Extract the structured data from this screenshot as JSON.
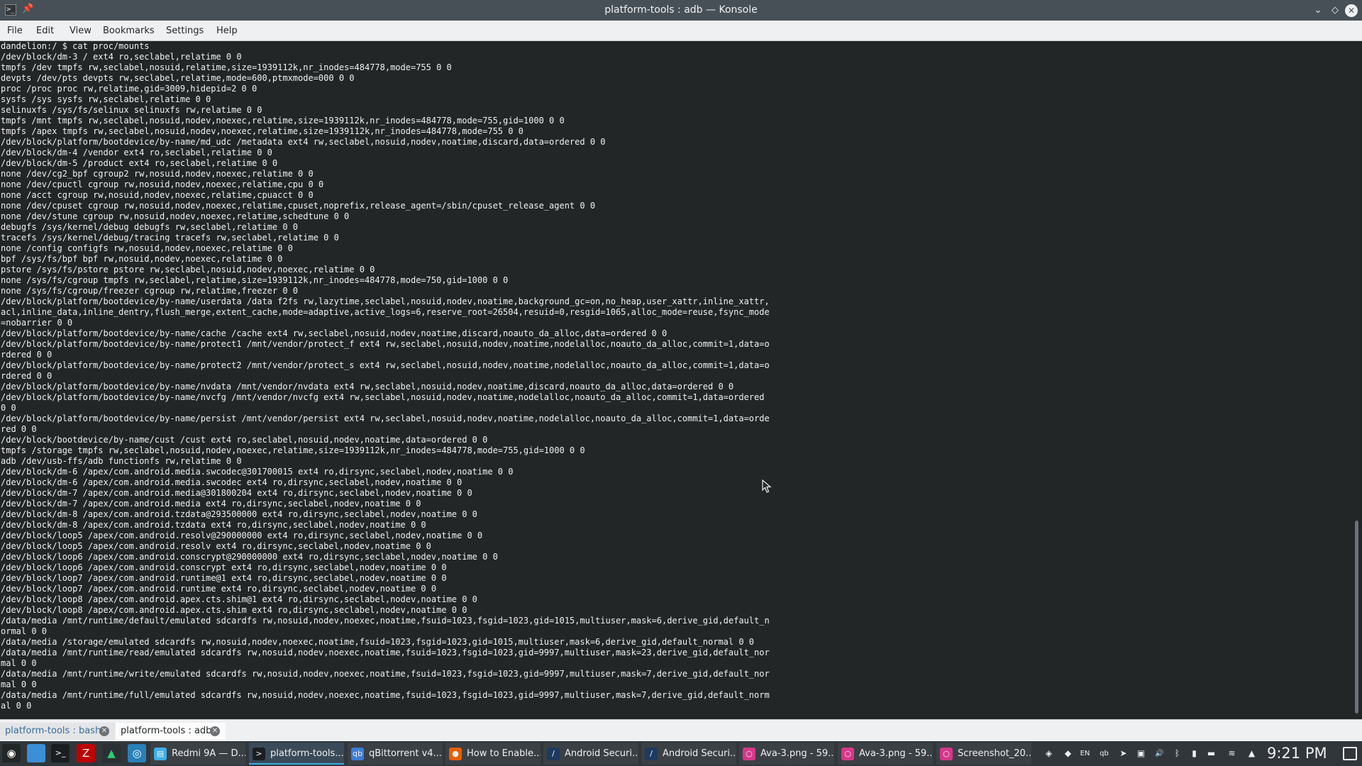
{
  "window": {
    "title": "platform-tools : adb — Konsole",
    "app_icon_glyph": ">_",
    "pin_glyph": "📌",
    "min_glyph": "⌄",
    "max_glyph": "◇",
    "close_glyph": "✕"
  },
  "menu": [
    "File",
    "Edit",
    "View",
    "Bookmarks",
    "Settings",
    "Help"
  ],
  "terminal_lines": [
    "dandelion:/ $ cat proc/mounts",
    "/dev/block/dm-3 / ext4 ro,seclabel,relatime 0 0",
    "tmpfs /dev tmpfs rw,seclabel,nosuid,relatime,size=1939112k,nr_inodes=484778,mode=755 0 0",
    "devpts /dev/pts devpts rw,seclabel,relatime,mode=600,ptmxmode=000 0 0",
    "proc /proc proc rw,relatime,gid=3009,hidepid=2 0 0",
    "sysfs /sys sysfs rw,seclabel,relatime 0 0",
    "selinuxfs /sys/fs/selinux selinuxfs rw,relatime 0 0",
    "tmpfs /mnt tmpfs rw,seclabel,nosuid,nodev,noexec,relatime,size=1939112k,nr_inodes=484778,mode=755,gid=1000 0 0",
    "tmpfs /apex tmpfs rw,seclabel,nosuid,nodev,noexec,relatime,size=1939112k,nr_inodes=484778,mode=755 0 0",
    "/dev/block/platform/bootdevice/by-name/md_udc /metadata ext4 rw,seclabel,nosuid,nodev,noatime,discard,data=ordered 0 0",
    "/dev/block/dm-4 /vendor ext4 ro,seclabel,relatime 0 0",
    "/dev/block/dm-5 /product ext4 ro,seclabel,relatime 0 0",
    "none /dev/cg2_bpf cgroup2 rw,nosuid,nodev,noexec,relatime 0 0",
    "none /dev/cpuctl cgroup rw,nosuid,nodev,noexec,relatime,cpu 0 0",
    "none /acct cgroup rw,nosuid,nodev,noexec,relatime,cpuacct 0 0",
    "none /dev/cpuset cgroup rw,nosuid,nodev,noexec,relatime,cpuset,noprefix,release_agent=/sbin/cpuset_release_agent 0 0",
    "none /dev/stune cgroup rw,nosuid,nodev,noexec,relatime,schedtune 0 0",
    "debugfs /sys/kernel/debug debugfs rw,seclabel,relatime 0 0",
    "tracefs /sys/kernel/debug/tracing tracefs rw,seclabel,relatime 0 0",
    "none /config configfs rw,nosuid,nodev,noexec,relatime 0 0",
    "bpf /sys/fs/bpf bpf rw,nosuid,nodev,noexec,relatime 0 0",
    "pstore /sys/fs/pstore pstore rw,seclabel,nosuid,nodev,noexec,relatime 0 0",
    "none /sys/fs/cgroup tmpfs rw,seclabel,relatime,size=1939112k,nr_inodes=484778,mode=750,gid=1000 0 0",
    "none /sys/fs/cgroup/freezer cgroup rw,relatime,freezer 0 0",
    "/dev/block/platform/bootdevice/by-name/userdata /data f2fs rw,lazytime,seclabel,nosuid,nodev,noatime,background_gc=on,no_heap,user_xattr,inline_xattr,",
    "acl,inline_data,inline_dentry,flush_merge,extent_cache,mode=adaptive,active_logs=6,reserve_root=26504,resuid=0,resgid=1065,alloc_mode=reuse,fsync_mode",
    "=nobarrier 0 0",
    "/dev/block/platform/bootdevice/by-name/cache /cache ext4 rw,seclabel,nosuid,nodev,noatime,discard,noauto_da_alloc,data=ordered 0 0",
    "/dev/block/platform/bootdevice/by-name/protect1 /mnt/vendor/protect_f ext4 rw,seclabel,nosuid,nodev,noatime,nodelalloc,noauto_da_alloc,commit=1,data=o",
    "rdered 0 0",
    "/dev/block/platform/bootdevice/by-name/protect2 /mnt/vendor/protect_s ext4 rw,seclabel,nosuid,nodev,noatime,nodelalloc,noauto_da_alloc,commit=1,data=o",
    "rdered 0 0",
    "/dev/block/platform/bootdevice/by-name/nvdata /mnt/vendor/nvdata ext4 rw,seclabel,nosuid,nodev,noatime,discard,noauto_da_alloc,data=ordered 0 0",
    "/dev/block/platform/bootdevice/by-name/nvcfg /mnt/vendor/nvcfg ext4 rw,seclabel,nosuid,nodev,noatime,nodelalloc,noauto_da_alloc,commit=1,data=ordered",
    "0 0",
    "/dev/block/platform/bootdevice/by-name/persist /mnt/vendor/persist ext4 rw,seclabel,nosuid,nodev,noatime,nodelalloc,noauto_da_alloc,commit=1,data=orde",
    "red 0 0",
    "/dev/block/bootdevice/by-name/cust /cust ext4 ro,seclabel,nosuid,nodev,noatime,data=ordered 0 0",
    "tmpfs /storage tmpfs rw,seclabel,nosuid,nodev,noexec,relatime,size=1939112k,nr_inodes=484778,mode=755,gid=1000 0 0",
    "adb /dev/usb-ffs/adb functionfs rw,relatime 0 0",
    "/dev/block/dm-6 /apex/com.android.media.swcodec@301700015 ext4 ro,dirsync,seclabel,nodev,noatime 0 0",
    "/dev/block/dm-6 /apex/com.android.media.swcodec ext4 ro,dirsync,seclabel,nodev,noatime 0 0",
    "/dev/block/dm-7 /apex/com.android.media@301800204 ext4 ro,dirsync,seclabel,nodev,noatime 0 0",
    "/dev/block/dm-7 /apex/com.android.media ext4 ro,dirsync,seclabel,nodev,noatime 0 0",
    "/dev/block/dm-8 /apex/com.android.tzdata@293500000 ext4 ro,dirsync,seclabel,nodev,noatime 0 0",
    "/dev/block/dm-8 /apex/com.android.tzdata ext4 ro,dirsync,seclabel,nodev,noatime 0 0",
    "/dev/block/loop5 /apex/com.android.resolv@290000000 ext4 ro,dirsync,seclabel,nodev,noatime 0 0",
    "/dev/block/loop5 /apex/com.android.resolv ext4 ro,dirsync,seclabel,nodev,noatime 0 0",
    "/dev/block/loop6 /apex/com.android.conscrypt@290000000 ext4 ro,dirsync,seclabel,nodev,noatime 0 0",
    "/dev/block/loop6 /apex/com.android.conscrypt ext4 ro,dirsync,seclabel,nodev,noatime 0 0",
    "/dev/block/loop7 /apex/com.android.runtime@1 ext4 ro,dirsync,seclabel,nodev,noatime 0 0",
    "/dev/block/loop7 /apex/com.android.runtime ext4 ro,dirsync,seclabel,nodev,noatime 0 0",
    "/dev/block/loop8 /apex/com.android.apex.cts.shim@1 ext4 ro,dirsync,seclabel,nodev,noatime 0 0",
    "/dev/block/loop8 /apex/com.android.apex.cts.shim ext4 ro,dirsync,seclabel,nodev,noatime 0 0",
    "/data/media /mnt/runtime/default/emulated sdcardfs rw,nosuid,nodev,noexec,noatime,fsuid=1023,fsgid=1023,gid=1015,multiuser,mask=6,derive_gid,default_n",
    "ormal 0 0",
    "/data/media /storage/emulated sdcardfs rw,nosuid,nodev,noexec,noatime,fsuid=1023,fsgid=1023,gid=1015,multiuser,mask=6,derive_gid,default_normal 0 0",
    "/data/media /mnt/runtime/read/emulated sdcardfs rw,nosuid,nodev,noexec,noatime,fsuid=1023,fsgid=1023,gid=9997,multiuser,mask=23,derive_gid,default_nor",
    "mal 0 0",
    "/data/media /mnt/runtime/write/emulated sdcardfs rw,nosuid,nodev,noexec,noatime,fsuid=1023,fsgid=1023,gid=9997,multiuser,mask=7,derive_gid,default_nor",
    "mal 0 0",
    "/data/media /mnt/runtime/full/emulated sdcardfs rw,nosuid,nodev,noexec,noatime,fsuid=1023,fsgid=1023,gid=9997,multiuser,mask=7,derive_gid,default_norm",
    "al 0 0"
  ],
  "tabs": [
    {
      "label": "platform-tools : bash",
      "active": false,
      "close_glyph": "✕"
    },
    {
      "label": "platform-tools : adb",
      "active": true,
      "close_glyph": "✕"
    }
  ],
  "taskbar": {
    "launchers": [
      {
        "name": "app-launcher-icon",
        "glyph": "◉",
        "color": "#ffffff",
        "bg": "#232627"
      },
      {
        "name": "desktop-pager-icon",
        "glyph": "",
        "color": "#ffffff",
        "bg": "#3c8fd6"
      },
      {
        "name": "terminal-launcher-icon",
        "glyph": ">_",
        "color": "#ffffff",
        "bg": "#1b1e20"
      },
      {
        "name": "filezilla-launcher-icon",
        "glyph": "Z",
        "color": "#ffffff",
        "bg": "#bf0000"
      },
      {
        "name": "system-monitor-launcher-icon",
        "glyph": "▲",
        "color": "#2ecc71",
        "bg": "#2b3034"
      },
      {
        "name": "web-browser-launcher-icon",
        "glyph": "◎",
        "color": "#ffffff",
        "bg": "#2980b9"
      }
    ],
    "tasks": [
      {
        "label": "Redmi 9A — D...",
        "icon": "▤",
        "icon_bg": "#3daee9",
        "active": false
      },
      {
        "label": "platform-tools...",
        "icon": ">",
        "icon_bg": "#1b1e20",
        "active": true
      },
      {
        "label": "qBittorrent v4....",
        "icon": "qb",
        "icon_bg": "#3d7dd6",
        "active": false
      },
      {
        "label": "How to Enable...",
        "icon": "●",
        "icon_bg": "#e66000",
        "active": false
      },
      {
        "label": "Android Securi...",
        "icon": "/",
        "icon_bg": "#1e3a5f",
        "active": false
      },
      {
        "label": "Android Securi...",
        "icon": "/",
        "icon_bg": "#1e3a5f",
        "active": false
      },
      {
        "label": "Ava-3.png - 59...",
        "icon": "○",
        "icon_bg": "#d6378b",
        "active": false
      },
      {
        "label": "Ava-3.png - 59...",
        "icon": "○",
        "icon_bg": "#d6378b",
        "active": false
      },
      {
        "label": "Screenshot_20...",
        "icon": "○",
        "icon_bg": "#d6378b",
        "active": false
      }
    ],
    "tray": [
      {
        "name": "security-tray-icon",
        "glyph": "◈"
      },
      {
        "name": "anydesk-tray-icon",
        "glyph": "◆"
      },
      {
        "name": "keyboard-layout-tray-icon",
        "glyph": "EN"
      },
      {
        "name": "qbittorrent-tray-icon",
        "glyph": "qb"
      },
      {
        "name": "telegram-tray-icon",
        "glyph": "➤"
      },
      {
        "name": "clipboard-tray-icon",
        "glyph": "▣"
      },
      {
        "name": "volume-tray-icon",
        "glyph": "🔊"
      },
      {
        "name": "bluetooth-tray-icon",
        "glyph": "ᛒ"
      },
      {
        "name": "battery-tray-icon",
        "glyph": "▮"
      },
      {
        "name": "flag-tray-icon",
        "glyph": "▬"
      },
      {
        "name": "wifi-tray-icon",
        "glyph": "≋"
      },
      {
        "name": "tray-expand-icon",
        "glyph": "▲"
      }
    ],
    "clock": "9:21 PM"
  }
}
